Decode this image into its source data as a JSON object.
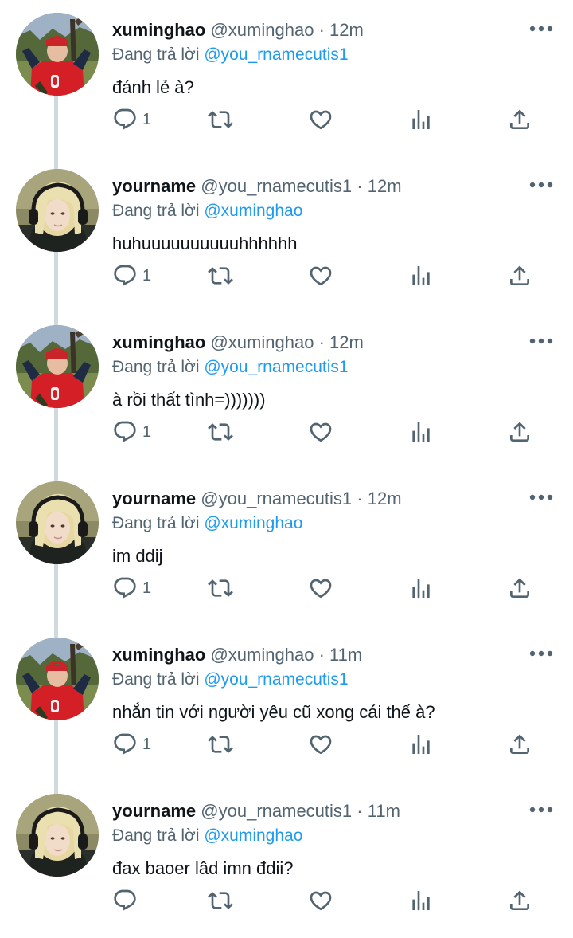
{
  "reply_prefix": "Đang trả lời",
  "tweets": [
    {
      "author": "xuminghao",
      "handle": "@xuminghao",
      "separator": "·",
      "time": "12m",
      "reply_to": "@you_rnamecutis1",
      "text": "đánh lẻ à?",
      "reply_count": "1",
      "avatar": "avatar-red-jersey"
    },
    {
      "author": "yourname",
      "handle": "@you_rnamecutis1",
      "separator": "·",
      "time": "12m",
      "reply_to": "@xuminghao",
      "text": "huhuuuuuuuuuuhhhhhh",
      "reply_count": "1",
      "avatar": "avatar-blonde-headphones"
    },
    {
      "author": "xuminghao",
      "handle": "@xuminghao",
      "separator": "·",
      "time": "12m",
      "reply_to": "@you_rnamecutis1",
      "text": "à rồi thất tình=)))))))",
      "reply_count": "1",
      "avatar": "avatar-red-jersey"
    },
    {
      "author": "yourname",
      "handle": "@you_rnamecutis1",
      "separator": "·",
      "time": "12m",
      "reply_to": "@xuminghao",
      "text": "im ddij",
      "reply_count": "1",
      "avatar": "avatar-blonde-headphones"
    },
    {
      "author": "xuminghao",
      "handle": "@xuminghao",
      "separator": "·",
      "time": "11m",
      "reply_to": "@you_rnamecutis1",
      "text": "nhắn tin với người yêu cũ xong cái thế à?",
      "reply_count": "1",
      "avatar": "avatar-red-jersey"
    },
    {
      "author": "yourname",
      "handle": "@you_rnamecutis1",
      "separator": "·",
      "time": "11m",
      "reply_to": "@xuminghao",
      "text": "đax baoer lâd imn đdii?",
      "reply_count": "",
      "avatar": "avatar-blonde-headphones"
    }
  ],
  "colors": {
    "text": "#0f1419",
    "secondary": "#536471",
    "link": "#1d9bf0",
    "thread_line": "#cfd9de"
  },
  "icons": [
    "reply-icon",
    "retweet-icon",
    "like-icon",
    "views-icon",
    "share-icon",
    "more-icon"
  ]
}
